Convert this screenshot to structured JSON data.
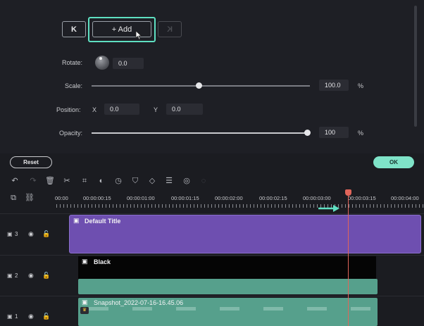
{
  "keyframe": {
    "prev_label": "K",
    "add_label": "+ Add",
    "next_label": "K"
  },
  "properties": {
    "rotate_label": "Rotate:",
    "rotate_value": "0.0",
    "scale_label": "Scale:",
    "scale_value": "100.0",
    "scale_unit": "%",
    "position_label": "Position:",
    "x_label": "X",
    "x_value": "0.0",
    "y_label": "Y",
    "y_value": "0.0",
    "opacity_label": "Opacity:",
    "opacity_value": "100",
    "opacity_unit": "%"
  },
  "actions": {
    "reset_label": "Reset",
    "ok_label": "OK"
  },
  "toolbar": {
    "icons": [
      "undo-icon",
      "redo-icon",
      "delete-icon",
      "cut-icon",
      "crop-icon",
      "color-icon",
      "speed-icon",
      "mark-icon",
      "keyframe-icon",
      "adjust-icon",
      "stabilize-icon",
      "silence-icon"
    ]
  },
  "ruler": {
    "ticks": [
      "00:00",
      "00:00:00:15",
      "00:00:01:00",
      "00:00:01:15",
      "00:00:02:00",
      "00:00:02:15",
      "00:00:03:00",
      "00:00:03:15",
      "00:00:04:00"
    ]
  },
  "tracks": [
    {
      "number": "3",
      "clip": "Default Title"
    },
    {
      "number": "2",
      "clip": "Black"
    },
    {
      "number": "1",
      "clip": "Snapshot_2022-07-16-16.45.06"
    }
  ],
  "colors": {
    "accent": "#5fe0c2",
    "title_clip": "#6e4fb0",
    "audio_clip": "#56a08c",
    "playhead": "#e0655a"
  }
}
